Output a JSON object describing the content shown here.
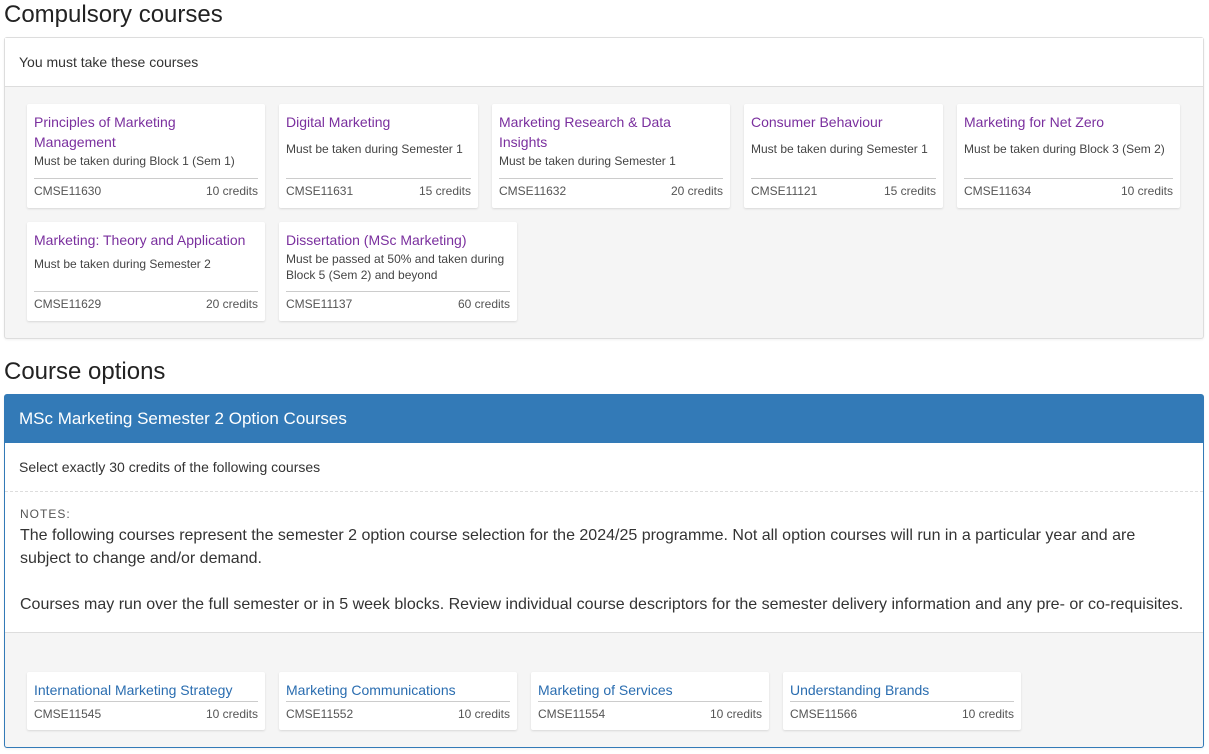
{
  "compulsory": {
    "heading": "Compulsory courses",
    "subheading": "You must take these courses",
    "courses": [
      {
        "title": "Principles of Marketing Management",
        "note": "Must be taken during Block 1 (Sem 1)",
        "code": "CMSE11630",
        "credits": "10 credits"
      },
      {
        "title": "Digital Marketing",
        "note": "Must be taken during Semester 1",
        "code": "CMSE11631",
        "credits": "15 credits"
      },
      {
        "title": "Marketing Research & Data Insights",
        "note": "Must be taken during Semester 1",
        "code": "CMSE11632",
        "credits": "20 credits"
      },
      {
        "title": "Consumer Behaviour",
        "note": "Must be taken during Semester 1",
        "code": "CMSE11121",
        "credits": "15 credits"
      },
      {
        "title": "Marketing for Net Zero",
        "note": "Must be taken during Block 3 (Sem 2)",
        "code": "CMSE11634",
        "credits": "10 credits"
      },
      {
        "title": "Marketing: Theory and Application",
        "note": "Must be taken during Semester 2",
        "code": "CMSE11629",
        "credits": "20 credits"
      },
      {
        "title": "Dissertation (MSc Marketing)",
        "note": "Must be passed at 50% and taken during Block 5 (Sem 2) and beyond",
        "code": "CMSE11137",
        "credits": "60 credits"
      }
    ]
  },
  "options": {
    "heading": "Course options",
    "group_title": "MSc Marketing Semester 2 Option Courses",
    "select_text": "Select exactly 30 credits of the following courses",
    "notes_label": "NOTES:",
    "notes_paragraph_1": "The following courses represent the semester 2 option course selection for the 2024/25 programme. Not all option courses will run in a particular year and are subject to change and/or demand.",
    "notes_paragraph_2": "Courses may run over the full semester or in 5 week blocks. Review individual course descriptors for the semester delivery information and any pre- or co-requisites.",
    "courses": [
      {
        "title": "International Marketing Strategy",
        "code": "CMSE11545",
        "credits": "10 credits"
      },
      {
        "title": "Marketing Communications",
        "code": "CMSE11552",
        "credits": "10 credits"
      },
      {
        "title": "Marketing of Services",
        "code": "CMSE11554",
        "credits": "10 credits"
      },
      {
        "title": "Understanding Brands",
        "code": "CMSE11566",
        "credits": "10 credits"
      }
    ]
  },
  "colors": {
    "visited_link": "#7a2f9e",
    "link": "#2a6db0",
    "panel_header": "#337ab7"
  }
}
